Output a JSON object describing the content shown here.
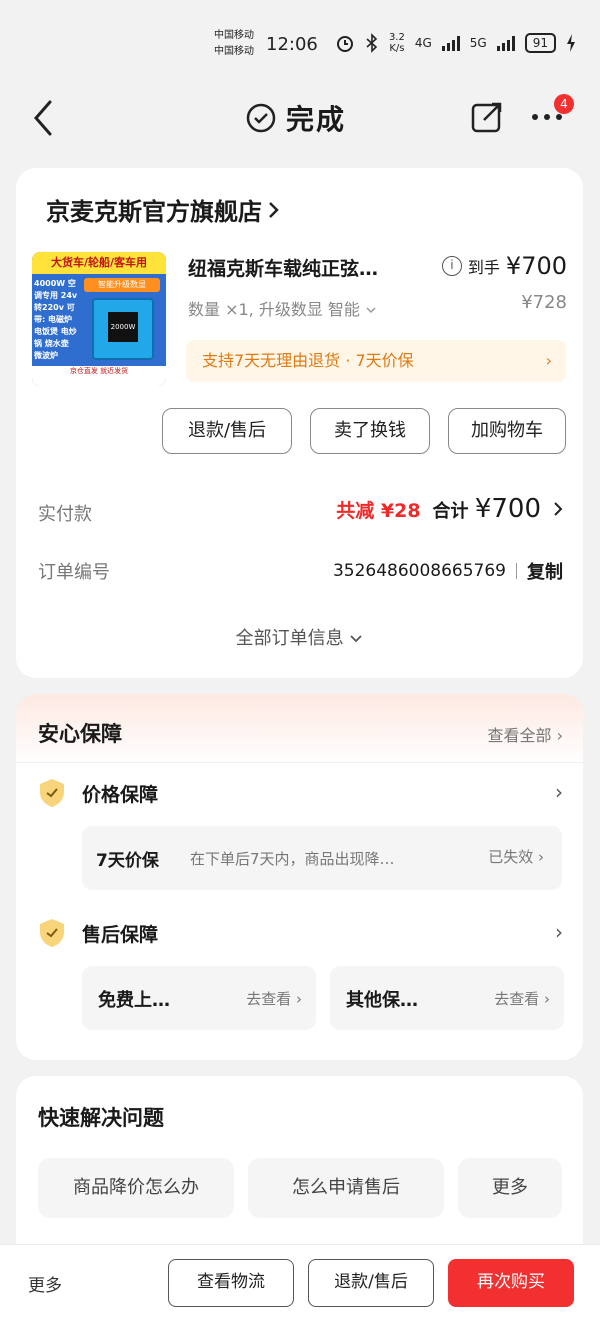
{
  "status": {
    "carrier1": "中国移动",
    "carrier2": "中国移动",
    "time": "12:06",
    "net_speed_value": "3.2",
    "net_speed_unit": "K/s",
    "net1": "4G",
    "net2": "5G",
    "battery": "91"
  },
  "nav": {
    "title": "完成",
    "badge": "4"
  },
  "shop": {
    "name": "京麦克斯官方旗舰店"
  },
  "product": {
    "image_top_text": "大货车/轮船/客车用",
    "image_side_text": "4000W 空调专用 24v转220v 可带: 电磁炉 电饭煲 电炒锅 烧水壶 微波炉",
    "image_tag": "智能升级数显",
    "image_screen": "2000W",
    "image_bottom_text": "京仓直发 就近发货",
    "title": "纽福克斯车载纯正弦…",
    "price_label": "到手",
    "price": "¥700",
    "spec": "数量 ×1, 升级数显 智能",
    "original_price": "¥728",
    "promise": "支持7天无理由退货 · 7天价保"
  },
  "actions": {
    "refund": "退款/售后",
    "sell": "卖了换钱",
    "cart": "加购物车"
  },
  "payment": {
    "label": "实付款",
    "discount": "共减 ¥28",
    "total_label": "合计",
    "total": "¥700"
  },
  "order": {
    "label": "订单编号",
    "number": "3526486008665769",
    "copy": "复制",
    "all_info": "全部订单信息"
  },
  "guarantee": {
    "title": "安心保障",
    "view_all": "查看全部",
    "price_title": "价格保障",
    "price_item_name": "7天价保",
    "price_item_desc": "在下单后7天内，商品出现降…",
    "price_item_status": "已失效",
    "after_title": "售后保障",
    "after_item1": "免费上…",
    "after_item1_action": "去查看",
    "after_item2": "其他保…",
    "after_item2_action": "去查看"
  },
  "quick": {
    "title": "快速解决问题",
    "chip1": "商品降价怎么办",
    "chip2": "怎么申请售后",
    "chip3": "更多"
  },
  "bottom": {
    "more": "更多",
    "track": "查看物流",
    "refund": "退款/售后",
    "rebuy": "再次购买"
  },
  "colors": {
    "accent_red": "#f23030",
    "promise_orange": "#e07a12"
  }
}
